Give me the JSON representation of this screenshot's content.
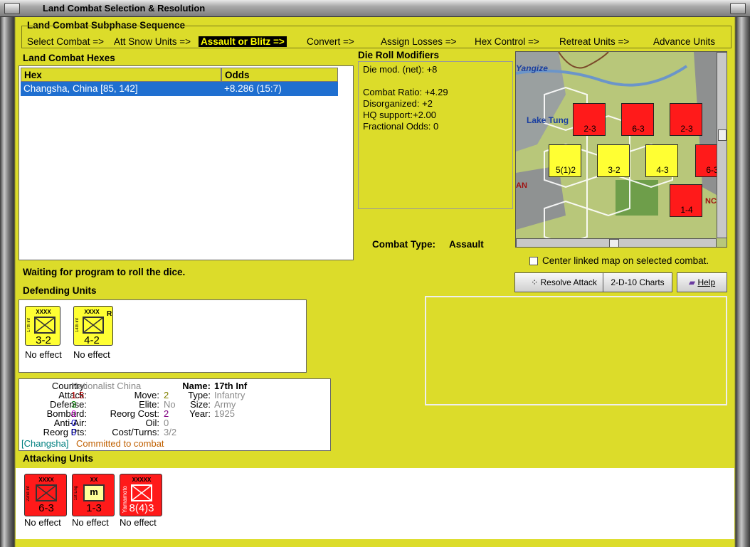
{
  "window": {
    "title": "Land Combat Selection & Resolution"
  },
  "subphase": {
    "title": "Land Combat Subphase Sequence",
    "steps": [
      "Select Combat =>",
      "Att Snow Units =>",
      "Assault or Blitz =>",
      "Convert =>",
      "Assign Losses =>",
      "Hex Control =>",
      "Retreat Units =>",
      "Advance Units"
    ],
    "selected_index": 2
  },
  "hexes": {
    "title": "Land Combat Hexes",
    "col_hex": "Hex",
    "col_odds": "Odds",
    "rows": [
      {
        "hex": "Changsha, China [85, 142]",
        "odds": "+8.286 (15:7)"
      }
    ]
  },
  "modifiers": {
    "title": "Die Roll Modifiers",
    "net": "Die mod. (net): +8",
    "lines": [
      "Combat Ratio: +4.29",
      "Disorganized: +2",
      "HQ support:+2.00",
      "Fractional Odds: 0"
    ]
  },
  "combat_type": {
    "label": "Combat Type:",
    "value": "Assault"
  },
  "center_map": {
    "label": "Center linked map on selected combat.",
    "checked": false
  },
  "buttons": {
    "resolve": "Resolve Attack",
    "charts": "2-D-10 Charts",
    "help": "Help"
  },
  "status": "Waiting for program to roll the dice.",
  "defending": {
    "title": "Defending Units",
    "units": [
      {
        "size": "XXXX",
        "name": "17th Inf",
        "strength": "3-2",
        "result": "No effect",
        "color": "yellow",
        "flag": ""
      },
      {
        "size": "XXXX",
        "name": "14th Inf",
        "strength": "4-2",
        "result": "No effect",
        "color": "yellow",
        "flag": "R"
      }
    ]
  },
  "details": {
    "country_label": "Country:",
    "country": "Nationalist China",
    "attack_label": "Attack:",
    "attack": "1.5",
    "defense_label": "Defense:",
    "defense": "3",
    "bombard_label": "Bombard:",
    "bombard": "0",
    "antiair_label": "Anti-Air:",
    "antiair": "0",
    "reorg_label": "Reorg Pts:",
    "reorg": "0",
    "move_label": "Move:",
    "move": "2",
    "elite_label": "Elite:",
    "elite": "No",
    "reorgcost_label": "Reorg Cost:",
    "reorgcost": "2",
    "oil_label": "Oil:",
    "oil": "0",
    "cost_label": "Cost/Turns:",
    "cost": "3/2",
    "name_label": "Name:",
    "name": "17th Inf",
    "type_label": "Type:",
    "type": "Infantry",
    "size_label": "Size:",
    "size": "Army",
    "year_label": "Year:",
    "year": "1925",
    "location": "[Changsha]",
    "status": "Committed to combat"
  },
  "attacking": {
    "title": "Attacking Units",
    "units": [
      {
        "size": "XXXX",
        "name": "22nd Inf",
        "strength": "6-3",
        "result": "No effect",
        "color": "red",
        "kind": "inf"
      },
      {
        "size": "XX",
        "name": "1st Eng",
        "strength": "1-3",
        "result": "No effect",
        "color": "red",
        "kind": "eng"
      },
      {
        "size": "XXXXX",
        "name": "Yamamoto",
        "strength": "8(4)3",
        "result": "No effect",
        "color": "red",
        "kind": "hq"
      }
    ]
  },
  "map": {
    "labels": [
      "Yangize",
      "Lake Tung",
      "AN",
      "NC"
    ],
    "counters": [
      {
        "s": "2-3",
        "c": "red",
        "n": "3"
      },
      {
        "s": "6-3",
        "c": "red",
        "n": "3"
      },
      {
        "s": "2-3",
        "c": "red",
        "n": "2"
      },
      {
        "s": "5(1)2",
        "c": "yellow",
        "n": ""
      },
      {
        "s": "3-2",
        "c": "yellow",
        "n": "2"
      },
      {
        "s": "4-3",
        "c": "yellow",
        "n": "3"
      },
      {
        "s": "6-3",
        "c": "red",
        "n": ""
      },
      {
        "s": "1-4",
        "c": "red",
        "n": "2"
      }
    ]
  },
  "colors": {
    "panel": "#dcdc2a",
    "selected_row": "#1f6fd0",
    "attack": "#c00000",
    "defense": "#008000",
    "bombard": "#cc00cc",
    "antiair": "#0000cc"
  }
}
